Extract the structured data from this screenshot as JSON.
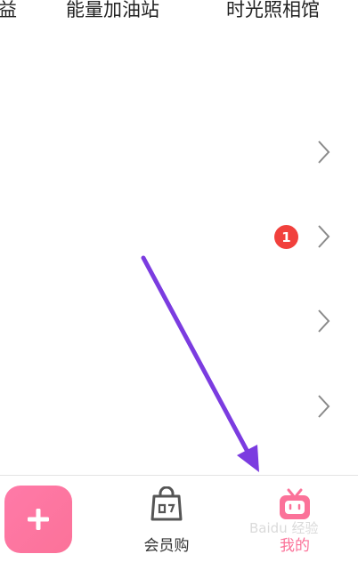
{
  "top_tabs": [
    "益",
    "能量加油站",
    "时光照相馆"
  ],
  "list": {
    "badge_count": "1"
  },
  "bottom_nav": {
    "add_icon": "plus-icon",
    "items": [
      {
        "label": "会员购",
        "icon": "shopping-bag-icon"
      },
      {
        "label": "我的",
        "icon": "tv-icon",
        "active": true
      }
    ]
  },
  "watermark": "Baidu 经验",
  "colors": {
    "accent_pink": "#fb7299",
    "badge_red": "#f1403c",
    "annotation_arrow": "#7b3ce0",
    "inactive_gray": "#555555"
  }
}
